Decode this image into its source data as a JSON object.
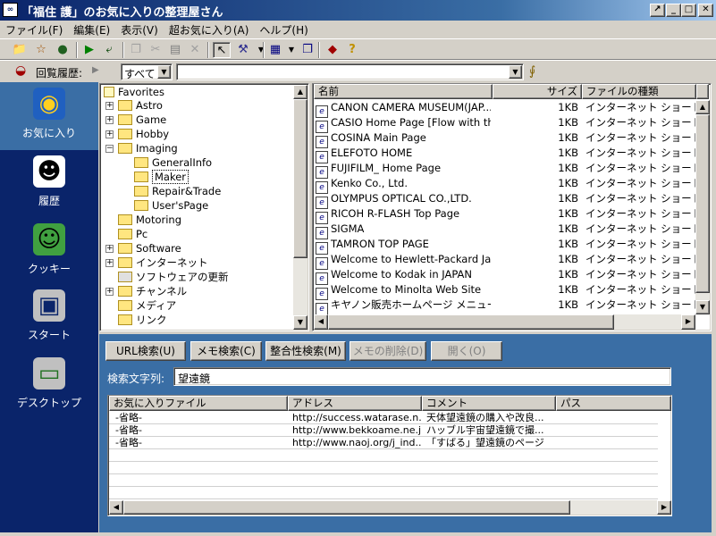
{
  "window": {
    "title": "「福住 護」のお気に入りの整理屋さん",
    "icon": "app-icon"
  },
  "menu": [
    "ファイル(F)",
    "編集(E)",
    "表示(V)",
    "超お気に入り(A)",
    "ヘルプ(H)"
  ],
  "address_bar": {
    "label": "回覧履歴:",
    "filter_value": "すべて",
    "url_value": ""
  },
  "sidebar": [
    {
      "label": "お気に入り",
      "icon": "globe-icon",
      "selected": true
    },
    {
      "label": "履歴",
      "icon": "history-icon",
      "selected": false
    },
    {
      "label": "クッキー",
      "icon": "cookie-icon",
      "selected": false
    },
    {
      "label": "スタート",
      "icon": "computer-icon",
      "selected": false
    },
    {
      "label": "デスクトップ",
      "icon": "desktop-icon",
      "selected": false
    }
  ],
  "tree": {
    "root": "Favorites",
    "items": [
      "Astro",
      "Game",
      "Hobby",
      "Imaging",
      "GeneralInfo",
      "Maker",
      "Repair&Trade",
      "User'sPage",
      "Motoring",
      "Pc",
      "Software",
      "インターネット",
      "ソフトウェアの更新",
      "チャンネル",
      "メディア",
      "リンク"
    ]
  },
  "file_list": {
    "columns": [
      "名前",
      "サイズ",
      "ファイルの種類"
    ],
    "rows": [
      {
        "name": "CANON CAMERA MUSEUM(JAP...",
        "size": "1KB",
        "type": "インターネット ショートカット"
      },
      {
        "name": "CASIO Home Page [Flow with th...",
        "size": "1KB",
        "type": "インターネット ショートカット"
      },
      {
        "name": "COSINA Main Page",
        "size": "1KB",
        "type": "インターネット ショートカット"
      },
      {
        "name": "ELEFOTO HOME",
        "size": "1KB",
        "type": "インターネット ショートカット"
      },
      {
        "name": "FUJIFILM_ Home Page",
        "size": "1KB",
        "type": "インターネット ショートカット"
      },
      {
        "name": "Kenko Co., Ltd.",
        "size": "1KB",
        "type": "インターネット ショートカット"
      },
      {
        "name": "OLYMPUS OPTICAL CO.,LTD.",
        "size": "1KB",
        "type": "インターネット ショートカット"
      },
      {
        "name": "RICOH R-FLASH Top Page",
        "size": "1KB",
        "type": "インターネット ショートカット"
      },
      {
        "name": "SIGMA",
        "size": "1KB",
        "type": "インターネット ショートカット"
      },
      {
        "name": "TAMRON TOP PAGE",
        "size": "1KB",
        "type": "インターネット ショートカット"
      },
      {
        "name": "Welcome to Hewlett-Packard Jap...",
        "size": "1KB",
        "type": "インターネット ショートカット"
      },
      {
        "name": "Welcome to Kodak in JAPAN",
        "size": "1KB",
        "type": "インターネット ショートカット"
      },
      {
        "name": "Welcome to Minolta Web Site",
        "size": "1KB",
        "type": "インターネット ショートカット"
      },
      {
        "name": "キヤノン販売ホームページ メニュー...",
        "size": "1KB",
        "type": "インターネット ショートカット"
      }
    ]
  },
  "search": {
    "buttons": [
      {
        "label": "URL検索(U)",
        "enabled": true
      },
      {
        "label": "メモ検索(C)",
        "enabled": true
      },
      {
        "label": "整合性検索(M)",
        "enabled": true
      },
      {
        "label": "メモの削除(D)",
        "enabled": false
      },
      {
        "label": "開く(O)",
        "enabled": false
      }
    ],
    "query_label": "検索文字列:",
    "query_value": "望遠鏡",
    "columns": [
      "お気に入りファイル",
      "アドレス",
      "コメント",
      "パス"
    ],
    "results": [
      {
        "file": "-省略-",
        "address": "http://success.watarase.n...",
        "comment": "天体望遠鏡の購入や改良..."
      },
      {
        "file": "-省略-",
        "address": "http://www.bekkoame.ne.j...",
        "comment": "ハッブル宇宙望遠鏡で撮..."
      },
      {
        "file": "-省略-",
        "address": "http://www.naoj.org/j_ind...",
        "comment": "「すばる」望遠鏡のページ"
      }
    ]
  },
  "colors": {
    "title_start": "#0a246a",
    "panel_blue": "#3a6ea5",
    "sidebar_blue": "#0a246a"
  }
}
